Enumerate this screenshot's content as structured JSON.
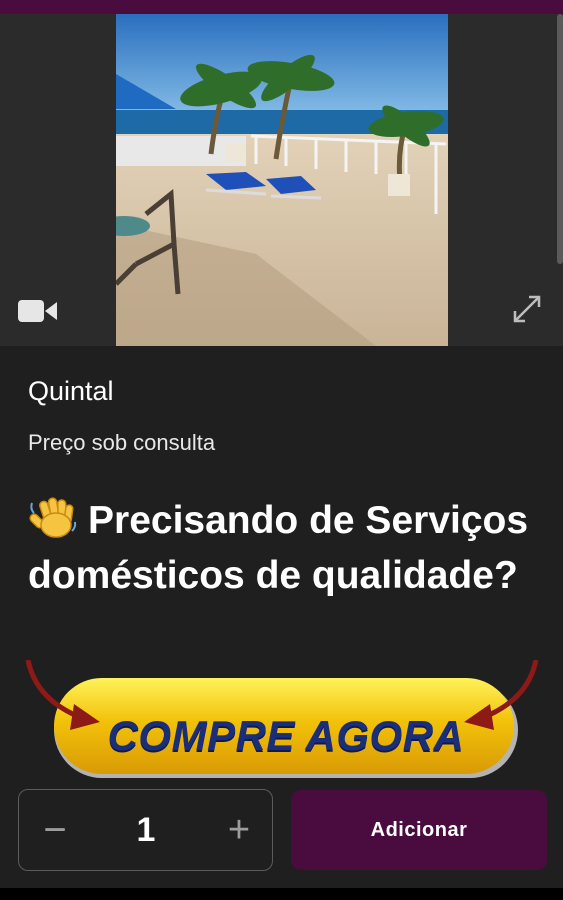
{
  "product": {
    "title": "Quintal",
    "price_text": "Preço sob consulta",
    "headline": "Precisando de Serviços domésticos de qualidade?"
  },
  "media": {
    "photo": "rooftop-terrace-palm-trees-sea",
    "icons": {
      "video": "video-camera-icon",
      "expand": "expand-icon",
      "wave": "waving-hand-icon"
    }
  },
  "cta": {
    "label": "COMPRE AGORA"
  },
  "cart": {
    "quantity": "1",
    "minus_glyph": "−",
    "plus_glyph": "+",
    "add_label": "Adicionar"
  },
  "colors": {
    "brand": "#4a0b3e",
    "background": "#1f1f1f",
    "cta_yellow": "#f2c20a",
    "cta_text": "#1b2f79",
    "arrow_red": "#8e1a17"
  }
}
